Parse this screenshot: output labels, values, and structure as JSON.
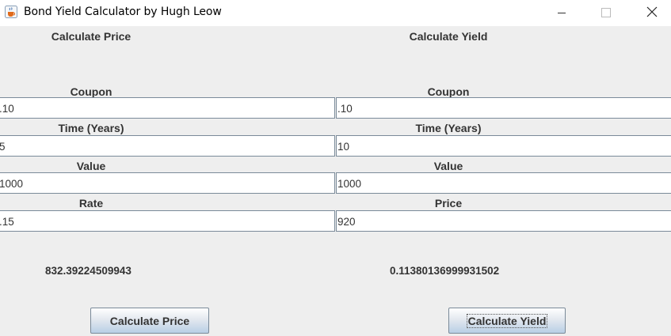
{
  "window": {
    "title": "Bond Yield Calculator by Hugh Leow",
    "icons": {
      "app": "java-cup-icon",
      "minimize": "minimize-icon",
      "maximize": "maximize-icon",
      "close": "close-icon"
    }
  },
  "price_panel": {
    "heading": "Calculate Price",
    "coupon_label": "Coupon",
    "coupon_value": ".10",
    "time_label": "Time (Years)",
    "time_value": "5",
    "value_label": "Value",
    "value_value": "1000",
    "rate_label": "Rate",
    "rate_value": ".15",
    "result": "832.39224509943",
    "button_label": "Calculate Price"
  },
  "yield_panel": {
    "heading": "Calculate Yield",
    "coupon_label": "Coupon",
    "coupon_value": ".10",
    "time_label": "Time (Years)",
    "time_value": "10",
    "value_label": "Value",
    "value_value": "1000",
    "price_label": "Price",
    "price_value": "920",
    "result": "0.11380136999931502",
    "button_label": "Calculate Yield"
  }
}
